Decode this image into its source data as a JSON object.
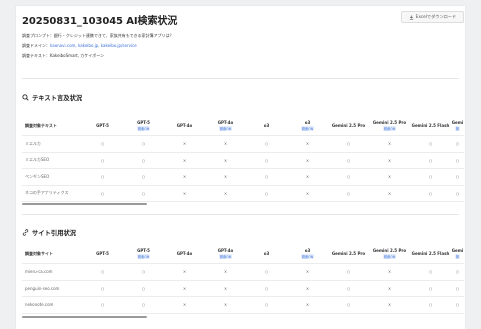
{
  "title": "20250831_103045 AI検索状況",
  "excel_label": "Excelでダウンロード",
  "meta": {
    "prompt_label": "調査プロンプト：",
    "prompt_value": "銀行・クレジット連携できて、家族共有もできる家計簿アプリは？",
    "domain_label": "調査ドメイン：",
    "domain_value": "kaonavi.com, kakeibo.jp, kakeibo.jp/service",
    "text_label": "調査テキスト：",
    "text_value": "KakeiboSmart, カケイボーン"
  },
  "columns": [
    {
      "name": "GPT-5",
      "badge": ""
    },
    {
      "name": "GPT-5",
      "badge": "検索ON"
    },
    {
      "name": "GPT-4o",
      "badge": ""
    },
    {
      "name": "GPT-4o",
      "badge": "検索ON"
    },
    {
      "name": "o3",
      "badge": ""
    },
    {
      "name": "o3",
      "badge": "検索ON"
    },
    {
      "name": "Gemini 2.5 Pro",
      "badge": ""
    },
    {
      "name": "Gemini 2.5 Pro",
      "badge": "検索ON"
    },
    {
      "name": "Gemini 2.5 Flash",
      "badge": ""
    },
    {
      "name": "Gemi",
      "badge": "検"
    }
  ],
  "text_section": {
    "title": "テキスト言及状況",
    "first_header": "調査対象テキスト",
    "rows": [
      {
        "label": "ミエルカ",
        "cells": [
          "○",
          "○",
          "×",
          "×",
          "○",
          "×",
          "○",
          "×",
          "○",
          "○"
        ]
      },
      {
        "label": "ミエルカSEO",
        "cells": [
          "○",
          "○",
          "×",
          "×",
          "○",
          "×",
          "○",
          "×",
          "○",
          "○"
        ]
      },
      {
        "label": "ペンギンSEO",
        "cells": [
          "○",
          "○",
          "×",
          "×",
          "○",
          "×",
          "○",
          "×",
          "○",
          "○"
        ]
      },
      {
        "label": "ネコの手アナリティクス",
        "cells": [
          "○",
          "○",
          "×",
          "×",
          "○",
          "×",
          "○",
          "×",
          "○",
          "○"
        ]
      }
    ]
  },
  "site_section": {
    "title": "サイト引用状況",
    "first_header": "調査対象サイト",
    "rows": [
      {
        "label": "mieru-ca.com",
        "cells": [
          "○",
          "○",
          "×",
          "×",
          "○",
          "×",
          "○",
          "×",
          "○",
          "○"
        ]
      },
      {
        "label": "penguin-seo.com",
        "cells": [
          "○",
          "○",
          "×",
          "×",
          "○",
          "×",
          "○",
          "×",
          "○",
          "○"
        ]
      },
      {
        "label": "nekonote.com",
        "cells": [
          "○",
          "○",
          "×",
          "×",
          "○",
          "×",
          "○",
          "×",
          "○",
          "○"
        ]
      }
    ]
  },
  "icons": {
    "download": "download-icon",
    "search": "magnifier-icon",
    "link": "link-icon"
  }
}
